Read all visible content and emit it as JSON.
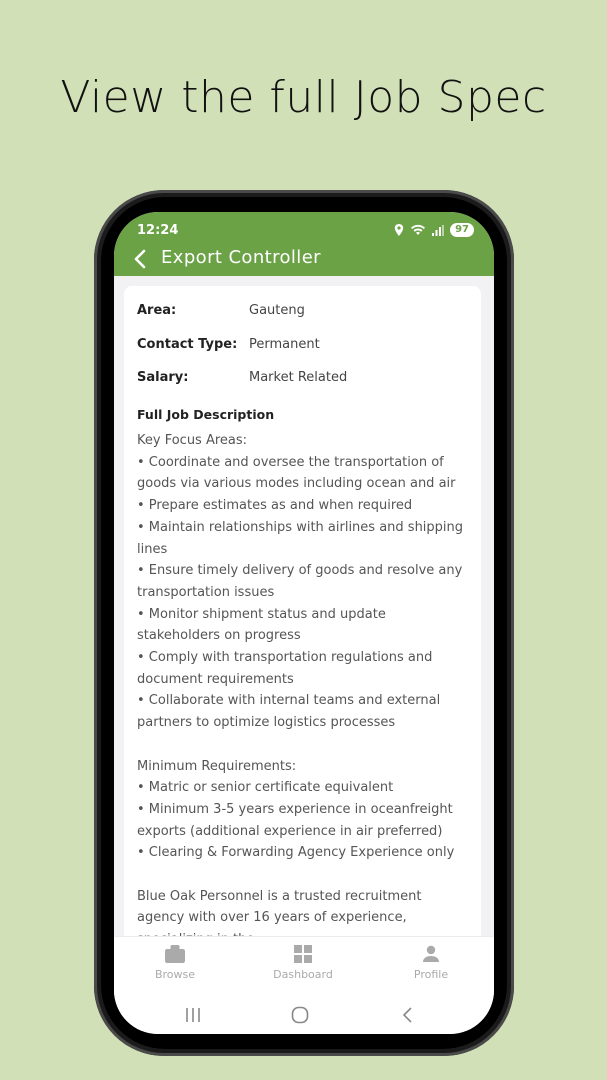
{
  "headline": "View the full Job Spec",
  "status_bar": {
    "time": "12:24",
    "battery": "97"
  },
  "app_bar": {
    "title": "Export Controller"
  },
  "details": {
    "area_label": "Area:",
    "area_value": "Gauteng",
    "contact_label": "Contact Type:",
    "contact_value": "Permanent",
    "salary_label": "Salary:",
    "salary_value": "Market Related"
  },
  "description": {
    "heading": "Full Job Description",
    "focus_title": "Key Focus Areas:",
    "focus_items": [
      "• Coordinate and oversee the transportation of goods via various modes including ocean and air",
      "• Prepare estimates as and when required",
      "• Maintain relationships with airlines and shipping lines",
      "• Ensure timely delivery of goods and resolve any transportation issues",
      "• Monitor shipment status and update stakeholders on progress",
      "• Comply with transportation regulations and document requirements",
      "• Collaborate with internal teams and external partners to optimize logistics processes"
    ],
    "req_title": "Minimum Requirements:",
    "req_items": [
      "• Matric or senior certificate equivalent",
      "• Minimum 3-5 years experience in oceanfreight exports (additional experience in air preferred)",
      "• Clearing & Forwarding Agency Experience only"
    ],
    "company_blurb": "Blue Oak Personnel is a trusted recruitment agency with over 16 years of experience, specializing in the"
  },
  "bottom_nav": {
    "browse": "Browse",
    "dashboard": "Dashboard",
    "profile": "Profile"
  },
  "colors": {
    "accent": "#6ba246",
    "background": "#d1e0b7"
  }
}
